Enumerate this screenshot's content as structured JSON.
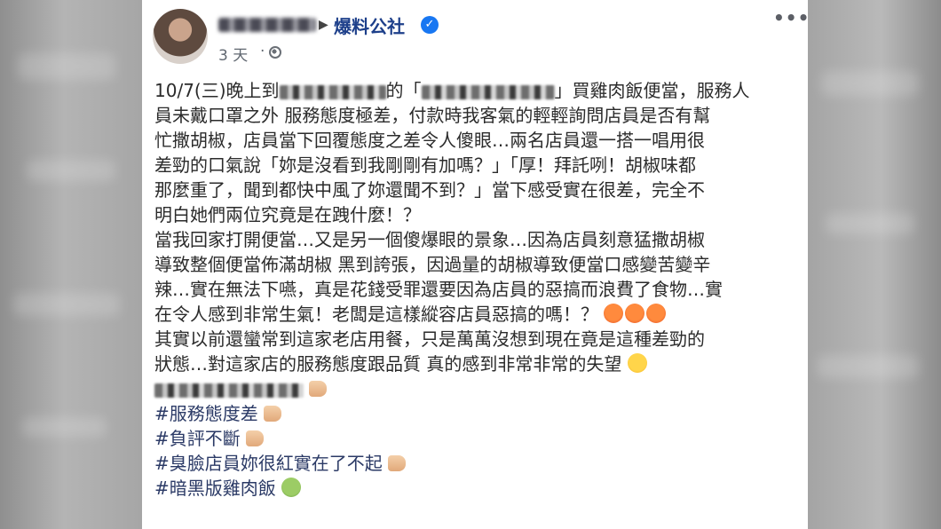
{
  "post": {
    "group_name": "爆料公社",
    "time": "3 天",
    "time_separator": "·",
    "more": "•••",
    "lines": [
      {
        "a": "10/7(三)晚上到",
        "b": "的「",
        "c": "」買雞肉飯便當，服務人"
      },
      "員未戴口罩之外 服務態度極差，付款時我客氣的輕輕詢問店員是否有幫",
      "忙撒胡椒，店員當下回覆態度之差令人傻眼…兩名店員還一搭一唱用很",
      "差勁的口氣說「妳是沒看到我剛剛有加嗎？」「厚！拜託咧！胡椒味都",
      "那麼重了，聞到都快中風了妳還聞不到？」當下感受實在很差，完全不",
      "明白她們兩位究竟是在跩什麼！？",
      "當我回家打開便當…又是另一個傻爆眼的景象…因為店員刻意猛撒胡椒",
      "導致整個便當佈滿胡椒 黑到誇張，因過量的胡椒導致便當口感變苦變辛",
      "辣…實在無法下嚥，真是花錢受罪還要因為店員的惡搞而浪費了食物…實",
      "在令人感到非常生氣！老闆是這樣縱容店員惡搞的嗎！？",
      "其實以前還蠻常到這家老店用餐，只是萬萬沒想到現在竟是這種差勁的",
      "狀態…對這家店的服務態度跟品質 真的感到非常非常的失望"
    ],
    "hashtags": [
      "#服務態度差",
      "#負評不斷",
      "#臭臉店員妳很紅實在了不起",
      "#暗黑版雞肉飯"
    ]
  }
}
